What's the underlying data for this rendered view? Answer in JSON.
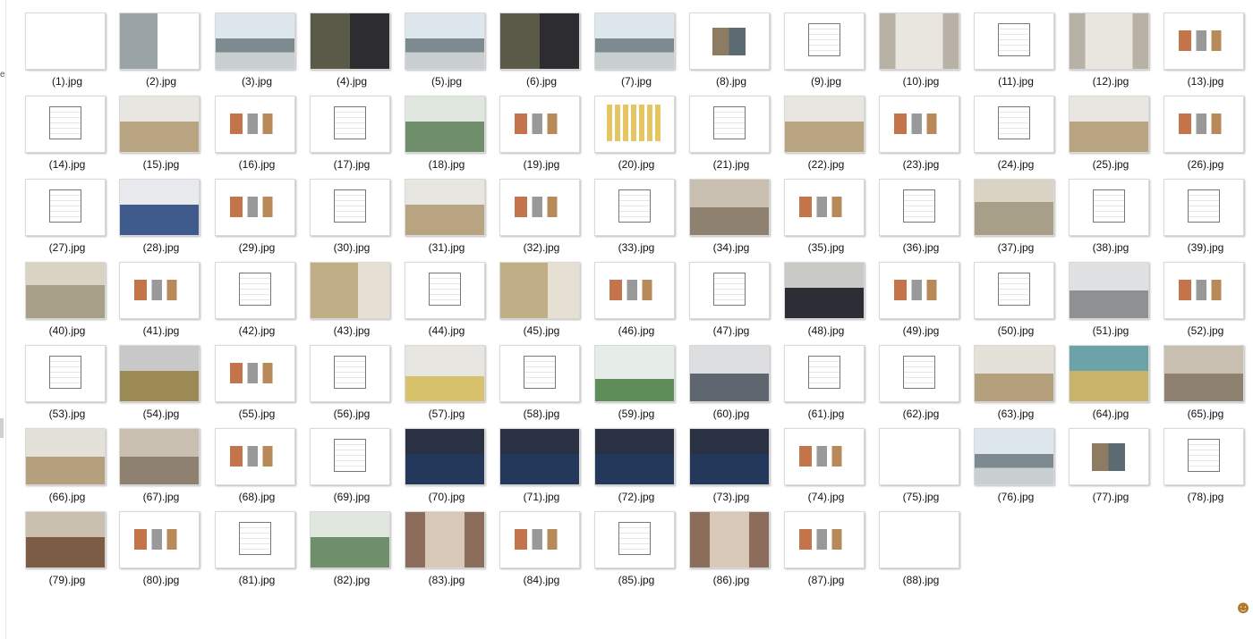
{
  "window": {
    "left_edge_glyph": "e"
  },
  "corner_icon": "user-avatar-icon",
  "files": [
    {
      "name": "(1).jpg",
      "kind": "cover"
    },
    {
      "name": "(2).jpg",
      "kind": "photo-doc"
    },
    {
      "name": "(3).jpg",
      "kind": "exterior"
    },
    {
      "name": "(4).jpg",
      "kind": "collage"
    },
    {
      "name": "(5).jpg",
      "kind": "exterior"
    },
    {
      "name": "(6).jpg",
      "kind": "collage"
    },
    {
      "name": "(7).jpg",
      "kind": "exterior"
    },
    {
      "name": "(8).jpg",
      "kind": "swatch"
    },
    {
      "name": "(9).jpg",
      "kind": "plan"
    },
    {
      "name": "(10).jpg",
      "kind": "corridor"
    },
    {
      "name": "(11).jpg",
      "kind": "plan"
    },
    {
      "name": "(12).jpg",
      "kind": "corridor"
    },
    {
      "name": "(13).jpg",
      "kind": "product"
    },
    {
      "name": "(14).jpg",
      "kind": "plan"
    },
    {
      "name": "(15).jpg",
      "kind": "room"
    },
    {
      "name": "(16).jpg",
      "kind": "product"
    },
    {
      "name": "(17).jpg",
      "kind": "plan"
    },
    {
      "name": "(18).jpg",
      "kind": "room-green"
    },
    {
      "name": "(19).jpg",
      "kind": "product"
    },
    {
      "name": "(20).jpg",
      "kind": "lockers"
    },
    {
      "name": "(21).jpg",
      "kind": "plan"
    },
    {
      "name": "(22).jpg",
      "kind": "room"
    },
    {
      "name": "(23).jpg",
      "kind": "product"
    },
    {
      "name": "(24).jpg",
      "kind": "plan"
    },
    {
      "name": "(25).jpg",
      "kind": "room"
    },
    {
      "name": "(26).jpg",
      "kind": "product"
    },
    {
      "name": "(27).jpg",
      "kind": "plan"
    },
    {
      "name": "(28).jpg",
      "kind": "room-blue"
    },
    {
      "name": "(29).jpg",
      "kind": "product"
    },
    {
      "name": "(30).jpg",
      "kind": "plan"
    },
    {
      "name": "(31).jpg",
      "kind": "room"
    },
    {
      "name": "(32).jpg",
      "kind": "product"
    },
    {
      "name": "(33).jpg",
      "kind": "plan"
    },
    {
      "name": "(34).jpg",
      "kind": "library"
    },
    {
      "name": "(35).jpg",
      "kind": "product"
    },
    {
      "name": "(36).jpg",
      "kind": "plan"
    },
    {
      "name": "(37).jpg",
      "kind": "hall"
    },
    {
      "name": "(38).jpg",
      "kind": "elevation"
    },
    {
      "name": "(39).jpg",
      "kind": "plan"
    },
    {
      "name": "(40).jpg",
      "kind": "hall"
    },
    {
      "name": "(41).jpg",
      "kind": "product"
    },
    {
      "name": "(42).jpg",
      "kind": "plan"
    },
    {
      "name": "(43).jpg",
      "kind": "toilet"
    },
    {
      "name": "(44).jpg",
      "kind": "plan"
    },
    {
      "name": "(45).jpg",
      "kind": "toilet"
    },
    {
      "name": "(46).jpg",
      "kind": "product"
    },
    {
      "name": "(47).jpg",
      "kind": "plan"
    },
    {
      "name": "(48).jpg",
      "kind": "meeting"
    },
    {
      "name": "(49).jpg",
      "kind": "product"
    },
    {
      "name": "(50).jpg",
      "kind": "plan"
    },
    {
      "name": "(51).jpg",
      "kind": "office"
    },
    {
      "name": "(52).jpg",
      "kind": "product"
    },
    {
      "name": "(53).jpg",
      "kind": "plan"
    },
    {
      "name": "(54).jpg",
      "kind": "canteen"
    },
    {
      "name": "(55).jpg",
      "kind": "product"
    },
    {
      "name": "(56).jpg",
      "kind": "plan"
    },
    {
      "name": "(57).jpg",
      "kind": "gym"
    },
    {
      "name": "(58).jpg",
      "kind": "plan"
    },
    {
      "name": "(59).jpg",
      "kind": "glass"
    },
    {
      "name": "(60).jpg",
      "kind": "lobby"
    },
    {
      "name": "(61).jpg",
      "kind": "plan"
    },
    {
      "name": "(62).jpg",
      "kind": "plan"
    },
    {
      "name": "(63).jpg",
      "kind": "library-light"
    },
    {
      "name": "(64).jpg",
      "kind": "library-color"
    },
    {
      "name": "(65).jpg",
      "kind": "library"
    },
    {
      "name": "(66).jpg",
      "kind": "library-light"
    },
    {
      "name": "(67).jpg",
      "kind": "library"
    },
    {
      "name": "(68).jpg",
      "kind": "product"
    },
    {
      "name": "(69).jpg",
      "kind": "plan"
    },
    {
      "name": "(70).jpg",
      "kind": "theater"
    },
    {
      "name": "(71).jpg",
      "kind": "theater"
    },
    {
      "name": "(72).jpg",
      "kind": "theater"
    },
    {
      "name": "(73).jpg",
      "kind": "theater"
    },
    {
      "name": "(74).jpg",
      "kind": "product"
    },
    {
      "name": "(75).jpg",
      "kind": "cover"
    },
    {
      "name": "(76).jpg",
      "kind": "exterior"
    },
    {
      "name": "(77).jpg",
      "kind": "swatch"
    },
    {
      "name": "(78).jpg",
      "kind": "plan"
    },
    {
      "name": "(79).jpg",
      "kind": "dining"
    },
    {
      "name": "(80).jpg",
      "kind": "product"
    },
    {
      "name": "(81).jpg",
      "kind": "plan"
    },
    {
      "name": "(82).jpg",
      "kind": "room-green"
    },
    {
      "name": "(83).jpg",
      "kind": "corridor-warm"
    },
    {
      "name": "(84).jpg",
      "kind": "product"
    },
    {
      "name": "(85).jpg",
      "kind": "plan"
    },
    {
      "name": "(86).jpg",
      "kind": "corridor-warm"
    },
    {
      "name": "(87).jpg",
      "kind": "product"
    },
    {
      "name": "(88).jpg",
      "kind": "cover"
    }
  ]
}
